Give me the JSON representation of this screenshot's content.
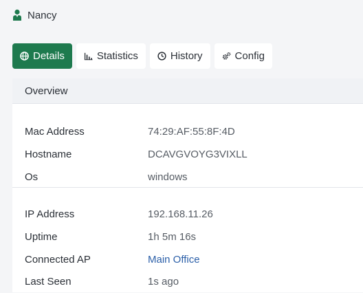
{
  "header": {
    "user_name": "Nancy",
    "icon": "person-icon"
  },
  "tabs": [
    {
      "label": "Details",
      "icon": "globe-icon",
      "active": true
    },
    {
      "label": "Statistics",
      "icon": "bar-chart-icon",
      "active": false
    },
    {
      "label": "History",
      "icon": "clock-icon",
      "active": false
    },
    {
      "label": "Config",
      "icon": "gears-icon",
      "active": false
    }
  ],
  "overview": {
    "title": "Overview",
    "group1": [
      {
        "label": "Mac Address",
        "value": "74:29:AF:55:8F:4D"
      },
      {
        "label": "Hostname",
        "value": "DCAVGVOYG3VIXLL"
      },
      {
        "label": "Os",
        "value": "windows"
      }
    ],
    "group2": [
      {
        "label": "IP Address",
        "value": "192.168.11.26"
      },
      {
        "label": "Uptime",
        "value": "1h 5m 16s"
      },
      {
        "label": "Connected AP",
        "value": "Main Office",
        "link": true
      },
      {
        "label": "Last Seen",
        "value": "1s ago"
      }
    ]
  },
  "colors": {
    "accent": "#1e7a4e",
    "link": "#2b5fa8",
    "background": "#f4f5f7"
  }
}
